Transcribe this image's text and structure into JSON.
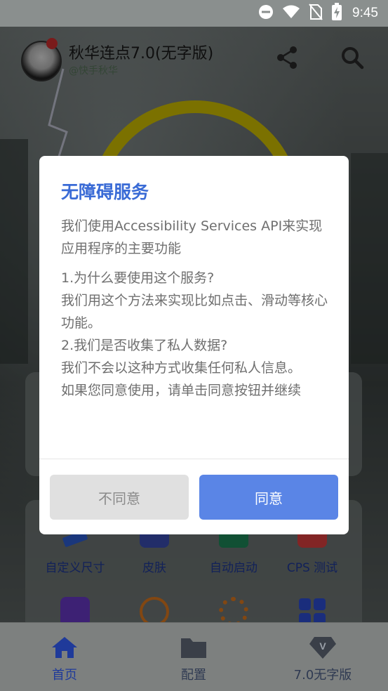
{
  "status_bar": {
    "time": "9:45",
    "icons": [
      "do-not-disturb-icon",
      "wifi-icon",
      "no-sim-icon",
      "battery-charging-icon"
    ]
  },
  "header": {
    "title": "秋华连点7.0(无字版)",
    "subtitle": "@快手秋华",
    "icons": [
      "share-icon",
      "search-icon"
    ]
  },
  "tools": [
    {
      "label": "自定义尺寸",
      "icon": "ruler-icon",
      "color": "#2e5fd6"
    },
    {
      "label": "皮肤",
      "icon": "skin-icon",
      "color": "#3c4fb5"
    },
    {
      "label": "自动启动",
      "icon": "auto-start-icon",
      "color": "#1e8a5a"
    },
    {
      "label": "CPS 测试",
      "icon": "cps-test-icon",
      "color": "#e04040"
    }
  ],
  "tools_row2_icons": [
    {
      "icon": "bar-chart-icon",
      "color": "#6a3ac8"
    },
    {
      "icon": "stopwatch-icon",
      "color": "#e07a20"
    },
    {
      "icon": "wheel-icon",
      "color": "#e07a20"
    },
    {
      "icon": "grid-icon",
      "color": "#2e4fd6"
    }
  ],
  "bottom_nav": {
    "items": [
      {
        "label": "首页",
        "icon": "home-icon",
        "active": true
      },
      {
        "label": "配置",
        "icon": "folder-icon",
        "active": false
      },
      {
        "label": "7.0无字版",
        "icon": "vip-icon",
        "active": false
      }
    ],
    "active_color": "#1f3a9a",
    "inactive_color": "#2f3a52"
  },
  "dialog": {
    "title": "无障碍服务",
    "intro": "我们使用Accessibility Services API来实现应用程序的主要功能",
    "q1": "1.为什么要使用这个服务?",
    "a1": "我们用这个方法来实现比如点击、滑动等核心功能。",
    "q2": "2.我们是否收集了私人数据?",
    "a2": "我们不会以这种方式收集任何私人信息。",
    "consent": "如果您同意使用，请单击同意按钮并继续",
    "disagree_label": "不同意",
    "agree_label": "同意",
    "accent_color": "#5a85e6"
  }
}
